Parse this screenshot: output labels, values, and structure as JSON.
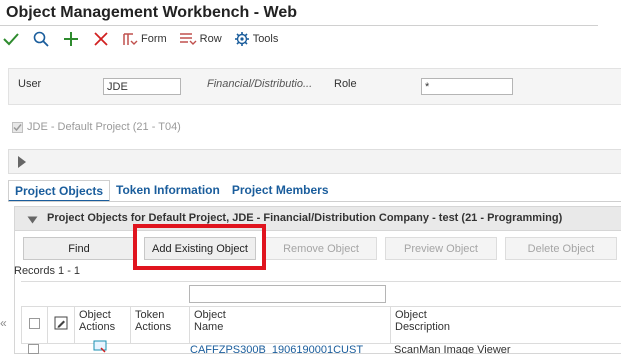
{
  "window": {
    "title": "Object Management Workbench - Web"
  },
  "toolbar": {
    "ok_icon": "checkmark-icon",
    "find_icon": "search-icon",
    "add_icon": "plus-icon",
    "cancel_icon": "close-icon",
    "form_label": "Form",
    "row_label": "Row",
    "tools_label": "Tools",
    "colors": {
      "ok": "#2e8b2e",
      "find": "#1a5d9c",
      "add": "#2e8b2e",
      "cancel": "#d12020",
      "menu_icon": "#c0504d",
      "tools_icon": "#1a5d9c"
    }
  },
  "header": {
    "user_label": "User",
    "user_value": "JDE",
    "company_text": "Financial/Distributio...",
    "role_label": "Role",
    "role_value": "*"
  },
  "default_project": {
    "label": "JDE - Default Project (21 - T04)",
    "checked": true,
    "disabled": true
  },
  "tabs": [
    {
      "label": "Project Objects",
      "active": true
    },
    {
      "label": "Token Information",
      "active": false
    },
    {
      "label": "Project Members",
      "active": false
    }
  ],
  "grid_panel": {
    "title": "Project Objects for Default Project, JDE - Financial/Distribution Company - test  (21 - Programming)",
    "buttons": {
      "find": "Find",
      "add_existing": "Add Existing Object",
      "remove": "Remove Object",
      "preview": "Preview Object",
      "delete": "Delete Object"
    },
    "records": "Records 1 - 1",
    "columns": [
      {
        "line1": "Object",
        "line2": "Actions"
      },
      {
        "line1": "Token",
        "line2": "Actions"
      },
      {
        "line1": "Object",
        "line2": "Name"
      },
      {
        "line1": "Object",
        "line2": "Description"
      }
    ],
    "rows": [
      {
        "object_name": "CAFFZPS300B_1906190001CUST",
        "object_description": "ScanMan Image Viewer"
      }
    ]
  },
  "colors": {
    "highlight": "#e0141e",
    "tab_active": "#1a5d9c",
    "link": "#1a5d9c"
  }
}
